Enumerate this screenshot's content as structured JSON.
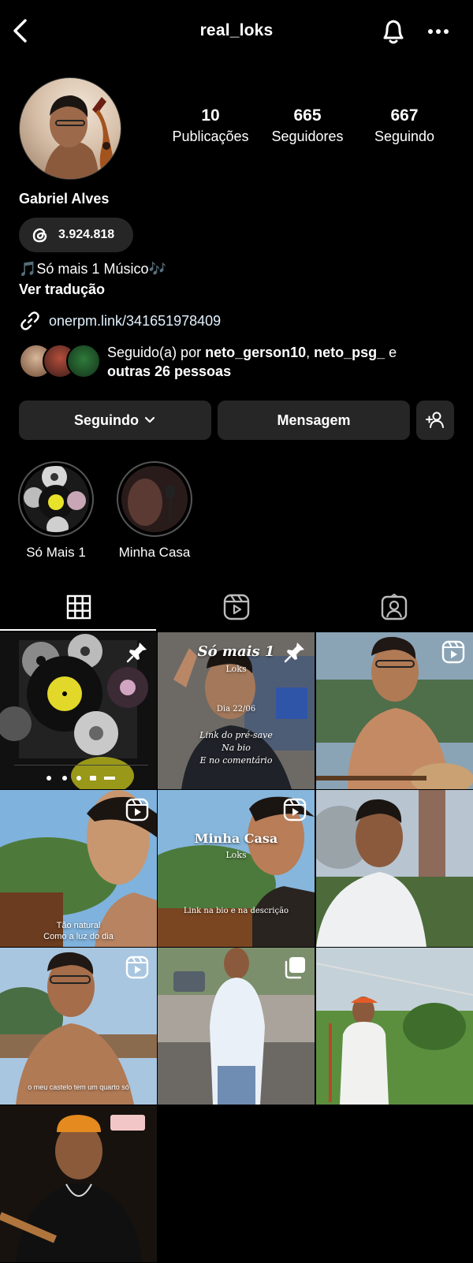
{
  "header": {
    "username": "real_loks"
  },
  "profile": {
    "name": "Gabriel Alves",
    "threads_count": "3.924.818",
    "bio": "🎵Só mais 1 Músico🎶",
    "translate": "Ver tradução",
    "link": "onerpm.link/341651978409",
    "followed_by_prefix": "Seguido(a) por ",
    "followed_by_user1": "neto_gerson10",
    "followed_by_sep": ", ",
    "followed_by_user2": "neto_psg_",
    "followed_by_and": " e",
    "followed_by_rest": "outras 26 pessoas"
  },
  "stats": [
    {
      "value": "10",
      "label": "Publicações"
    },
    {
      "value": "665",
      "label": "Seguidores"
    },
    {
      "value": "667",
      "label": "Seguindo"
    }
  ],
  "actions": {
    "following": "Seguindo",
    "message": "Mensagem"
  },
  "highlights": [
    {
      "label": "Só Mais 1"
    },
    {
      "label": "Minha Casa"
    }
  ],
  "posts": {
    "p2_title": "Só mais 1",
    "p2_sub": "Loks",
    "p2_date": "Dia 22/06",
    "p2_line1": "Link do pré-save",
    "p2_line2": "Na bio",
    "p2_line3": "E no comentário",
    "p4_line1": "Tão natural",
    "p4_line2": "Como a luz do dia",
    "p5_title": "Minha Casa",
    "p5_sub": "Loks",
    "p5_line": "Link na bio e na descrição",
    "p7_line": "o meu castelo tem um quarto só"
  },
  "colors": {
    "background": "#000000",
    "button": "#262626",
    "link": "#e0f1ff"
  }
}
